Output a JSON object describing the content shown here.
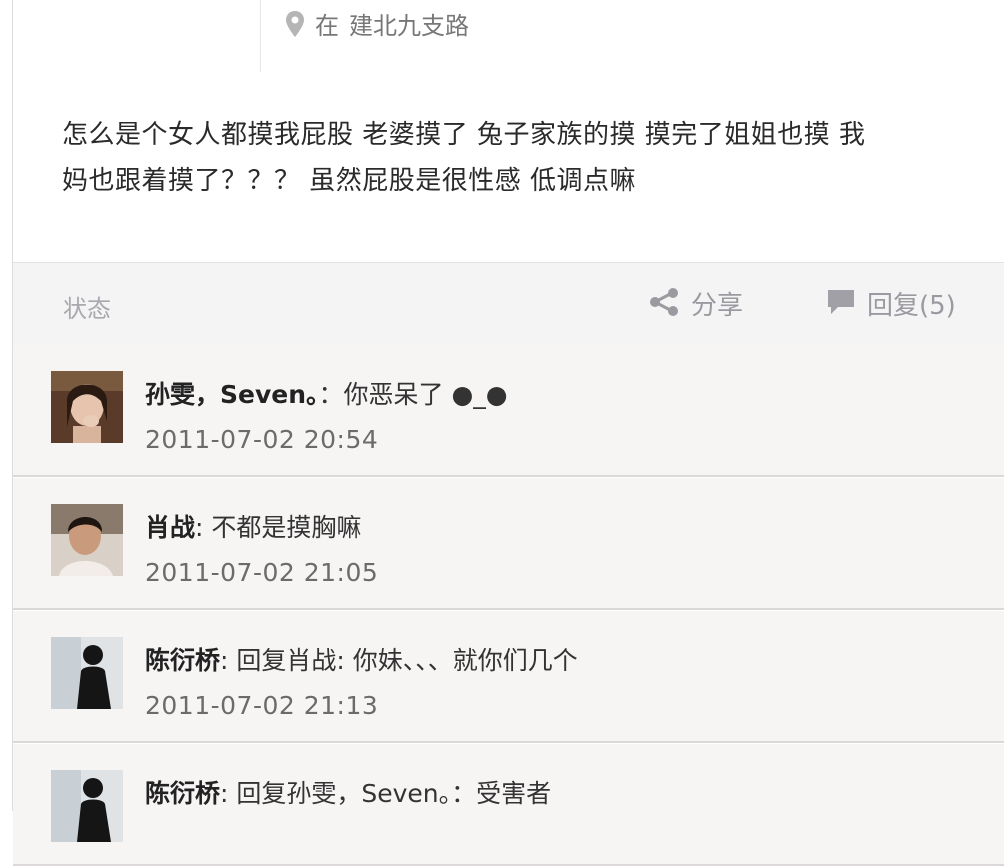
{
  "location": {
    "prefix": "在",
    "place": "建北九支路"
  },
  "post": {
    "text_line1": "怎么是个女人都摸我屁股 老婆摸了 兔子家族的摸 摸完了姐姐也摸 我",
    "text_line2": "妈也跟着摸了？？？ 虽然屁股是很性感 低调点嘛"
  },
  "actions": {
    "status_label": "状态",
    "share_label": "分享",
    "reply_label": "回复(5)"
  },
  "colors": {
    "action_bar_bg": "#f4f4f5",
    "comment_bg": "#f7f4f4",
    "muted_text": "#9a9aa0"
  },
  "comments": [
    {
      "author": "孙雯，Seven。",
      "text": "：你恶呆了 ●_●",
      "time": "2011-07-02 20:54",
      "avatar": "avatar-girl"
    },
    {
      "author": "肖战",
      "text": ": 不都是摸胸嘛",
      "time": "2011-07-02 21:05",
      "avatar": "avatar-boy"
    },
    {
      "author": "陈衍桥",
      "text": ": 回复肖战: 你妹、、、就你们几个",
      "time": "2011-07-02 21:13",
      "avatar": "avatar-silhouette"
    },
    {
      "author": "陈衍桥",
      "text": ": 回复孙雯，Seven。：受害者",
      "time": "",
      "avatar": "avatar-silhouette"
    }
  ]
}
